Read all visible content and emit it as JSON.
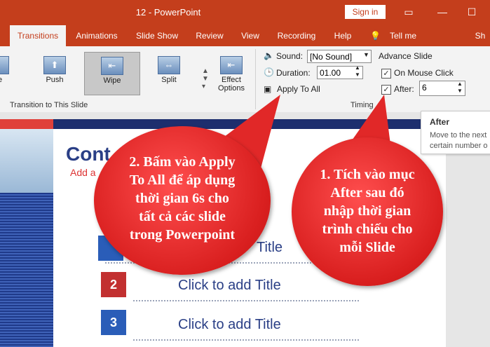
{
  "window": {
    "title": "12  -  PowerPoint",
    "sign_in": "Sign in"
  },
  "tabs": [
    {
      "label": "Transitions",
      "active": true
    },
    {
      "label": "Animations"
    },
    {
      "label": "Slide Show"
    },
    {
      "label": "Review"
    },
    {
      "label": "View"
    },
    {
      "label": "Recording"
    },
    {
      "label": "Help"
    },
    {
      "label": "Tell me"
    },
    {
      "label": "Sh"
    }
  ],
  "ribbon": {
    "transitions": [
      {
        "label": "de"
      },
      {
        "label": "Push"
      },
      {
        "label": "Wipe",
        "selected": true
      },
      {
        "label": "Split"
      }
    ],
    "effect_options": {
      "line1": "Effect",
      "line2": "Options"
    },
    "transition_group_label": "Transition to This Slide",
    "sound_label": "Sound:",
    "sound_value": "[No Sound]",
    "duration_label": "Duration:",
    "duration_value": "01.00",
    "apply_to_all": "Apply To All",
    "advance_slide_label": "Advance Slide",
    "on_mouse_click_label": "On Mouse Click",
    "on_mouse_click_checked": true,
    "after_label": "After:",
    "after_checked": true,
    "after_value": "6",
    "timing_group_label": "Timing"
  },
  "tooltip": {
    "title": "After",
    "line1": "Move to the next",
    "line2": "certain number o"
  },
  "slide": {
    "title": "Cont",
    "subtitle": "Add a",
    "rows": [
      {
        "number": "",
        "text": "Title"
      },
      {
        "number": "2",
        "text": "Click to add Title"
      },
      {
        "number": "3",
        "text": "Click to add Title"
      }
    ]
  },
  "callouts": {
    "left": {
      "lines": [
        "2. Bấm vào Apply",
        "To All để áp dụng",
        "thời gian 6s cho",
        "tất cả các slide",
        "trong Powerpoint"
      ]
    },
    "right": {
      "lines": [
        "1. Tích vào mục",
        "After sau đó",
        "nhập thời gian",
        "trình chiếu cho",
        "mỗi Slide"
      ]
    }
  },
  "colors": {
    "accent": "#c43e1c",
    "callout": "#e12828",
    "slide_title": "#2a3f86"
  }
}
